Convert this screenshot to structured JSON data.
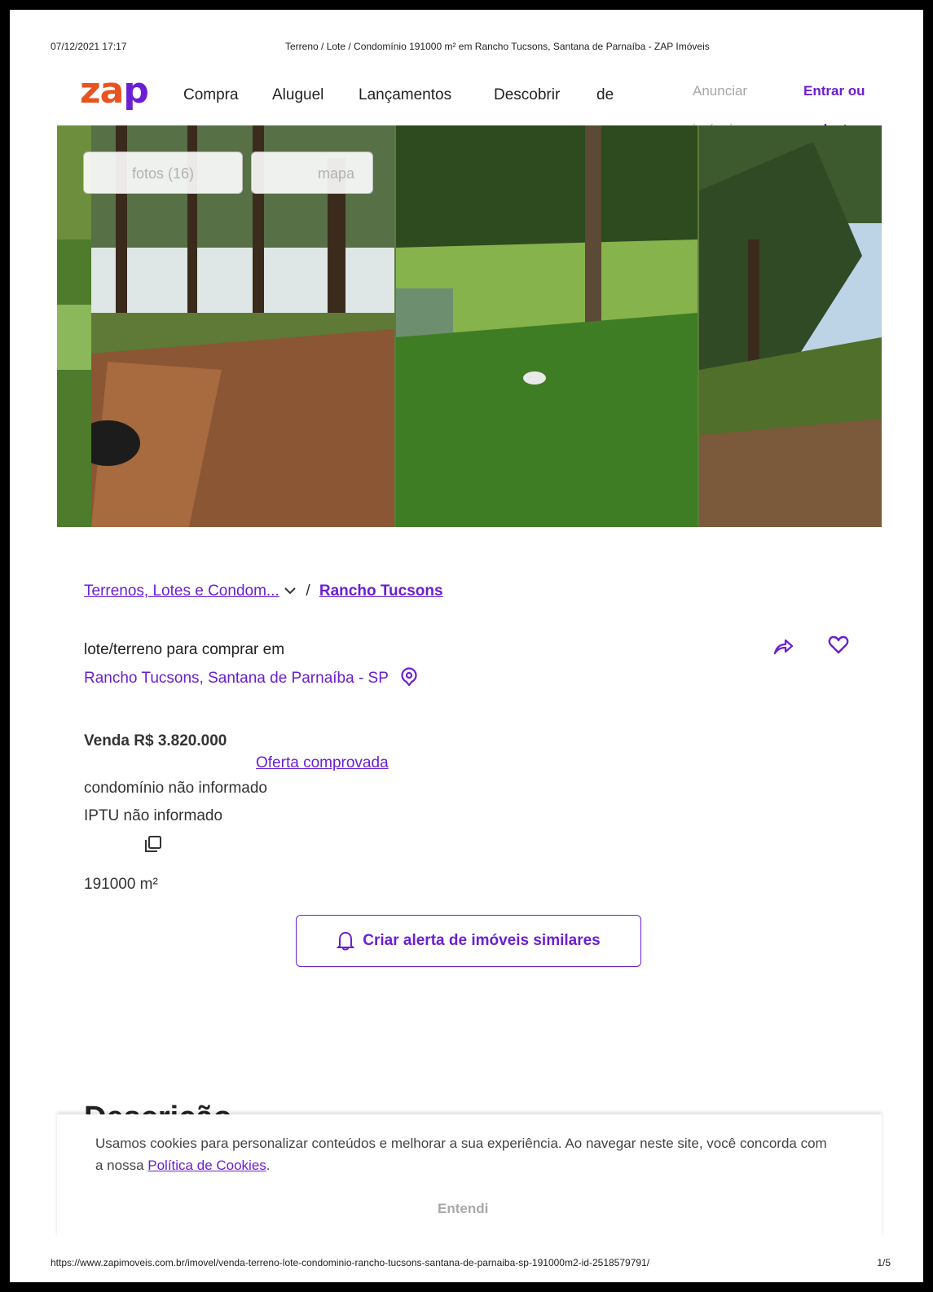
{
  "print_header": {
    "timestamp": "07/12/2021 17:17",
    "title": "Terreno / Lote / Condomínio 191000 m² em Rancho Tucsons, Santana de Parnaíba - ZAP Imóveis"
  },
  "nav": {
    "logo_a": "za",
    "logo_b": "p",
    "items": [
      "Compra",
      "Aluguel",
      "Lançamentos",
      "Descobrir",
      "de"
    ],
    "anunciar_line1": "Anunciar",
    "anunciar_line2": "imóveis",
    "login_line1": "Entrar ou",
    "login_line2": "cadastrar"
  },
  "gallery": {
    "fotos_label": "fotos (16)",
    "mapa_label": "mapa"
  },
  "breadcrumb": {
    "category": "Terrenos, Lotes e Condom...",
    "separator": "/",
    "neighborhood": "Rancho Tucsons"
  },
  "listing": {
    "type_text": "lote/terreno para comprar em",
    "address": "Rancho Tucsons, Santana de Parnaíba - SP",
    "price": "Venda R$ 3.820.000",
    "offer_link": "Oferta comprovada",
    "condo": "condomínio não informado",
    "iptu": "IPTU não informado",
    "area": "191000 m²"
  },
  "alert_button": "Criar alerta de imóveis similares",
  "description_heading": "Descrição",
  "cookie": {
    "text_before": "Usamos cookies para personalizar conteúdos e melhorar a sua experiência. Ao navegar neste site, você concorda com a nossa ",
    "link": "Política de Cookies",
    "text_after": ".",
    "button": "Entendi"
  },
  "print_footer": {
    "url": "https://www.zapimoveis.com.br/imovel/venda-terreno-lote-condominio-rancho-tucsons-santana-de-parnaiba-sp-191000m2-id-2518579791/",
    "page": "1/5"
  },
  "colors": {
    "brand_orange": "#e8531e",
    "brand_purple": "#6a1fd2"
  }
}
